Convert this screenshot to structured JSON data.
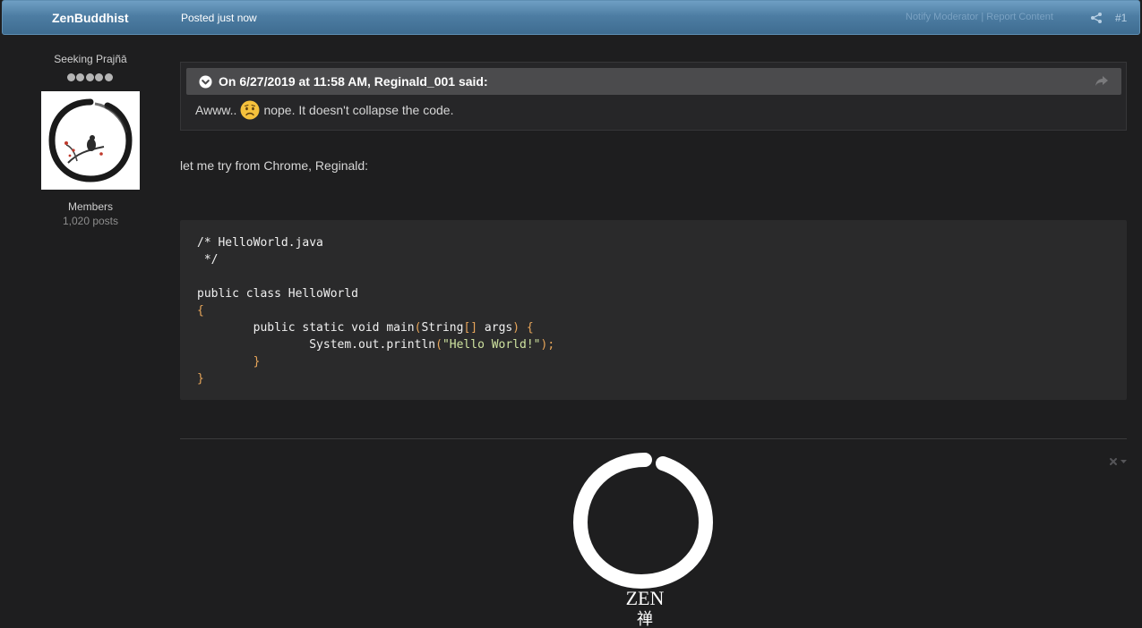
{
  "post": {
    "author": "ZenBuddhist",
    "posted_time": "Posted just now",
    "mod_actions": "Notify Moderator | Report Content",
    "post_number": "#1"
  },
  "author_info": {
    "rank_title": "Seeking Prajñā",
    "group": "Members",
    "post_count": "1,020 posts"
  },
  "quote": {
    "citation": "On 6/27/2019 at 11:58 AM, Reginald_001 said:",
    "text_before": "Awww..",
    "text_after": "nope. It doesn't collapse the code."
  },
  "body_text": "let me try from Chrome, Reginald:",
  "code": {
    "lines": [
      "/* HelloWorld.java",
      " */",
      "",
      "public class HelloWorld",
      "{",
      "        public static void main(String[] args) {",
      "                System.out.println(\"Hello World!\");",
      "        }",
      "}"
    ]
  },
  "signature": {
    "logo_text": "ZEN",
    "logo_glyph": "禅"
  },
  "colors": {
    "background": "#1e1e1f",
    "header_blue": "#4d7da3",
    "code_background": "#2a2a2b",
    "code_punctuation": "#e8a65a",
    "code_string": "#cfe3a0"
  },
  "icons": {
    "share": "share-icon",
    "quote_toggle": "chevron-circle-down-icon",
    "quote_share": "reply-arrow-icon",
    "emoji": "worried-face-emoji",
    "signature_options": "close-dropdown-icon"
  }
}
